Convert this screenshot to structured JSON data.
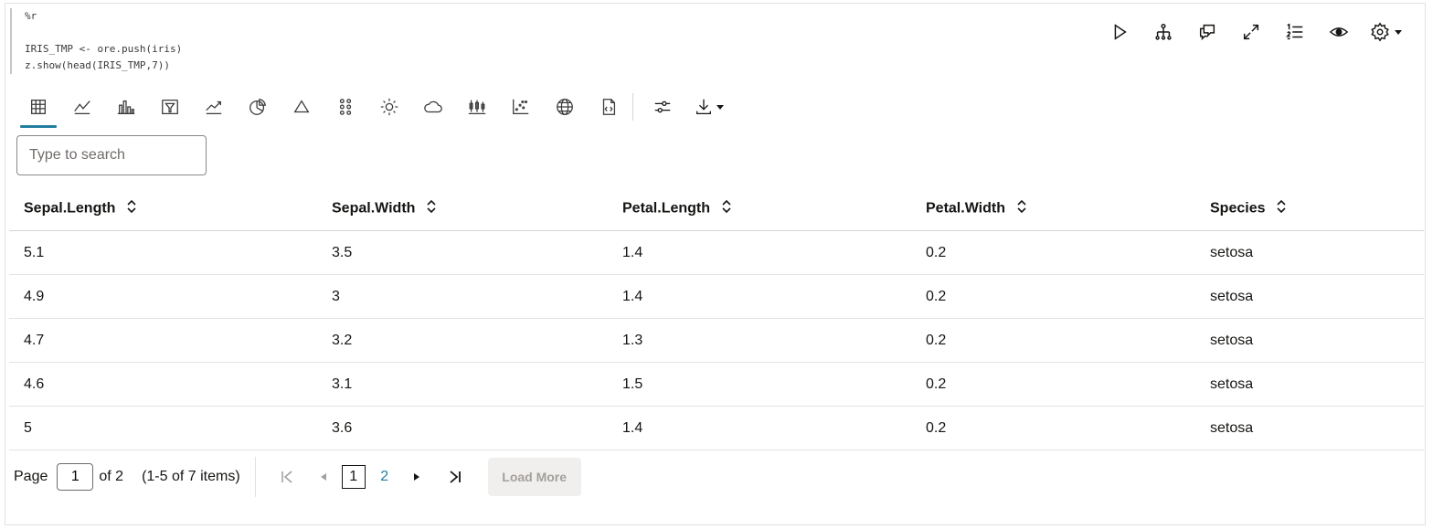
{
  "code": {
    "lines": [
      "%r",
      "",
      "IRIS_TMP <- ore.push(iris)",
      "z.show(head(IRIS_TMP,7))"
    ]
  },
  "cell_toolbar": {
    "icons": [
      "run-icon",
      "hierarchy-icon",
      "comments-icon",
      "expand-icon",
      "numbered-list-icon",
      "visibility-icon",
      "settings-icon"
    ]
  },
  "viz_toolbar": {
    "icons": [
      "table-icon",
      "line-chart-icon",
      "bar-chart-icon",
      "funnel-chart-icon",
      "trend-chart-icon",
      "pie-chart-icon",
      "triangle-chart-icon",
      "dot-grid-icon",
      "sun-icon",
      "cloud-icon",
      "boxplot-icon",
      "scatter-icon",
      "globe-icon",
      "code-file-icon",
      "settings-sliders-icon",
      "download-icon"
    ]
  },
  "search": {
    "placeholder": "Type to search"
  },
  "table": {
    "columns": [
      "Sepal.Length",
      "Sepal.Width",
      "Petal.Length",
      "Petal.Width",
      "Species"
    ],
    "rows": [
      [
        "5.1",
        "3.5",
        "1.4",
        "0.2",
        "setosa"
      ],
      [
        "4.9",
        "3",
        "1.4",
        "0.2",
        "setosa"
      ],
      [
        "4.7",
        "3.2",
        "1.3",
        "0.2",
        "setosa"
      ],
      [
        "4.6",
        "3.1",
        "1.5",
        "0.2",
        "setosa"
      ],
      [
        "5",
        "3.6",
        "1.4",
        "0.2",
        "setosa"
      ]
    ]
  },
  "pager": {
    "page_label": "Page",
    "page_value": "1",
    "of_label": "of 2",
    "range_label": "(1-5 of 7 items)",
    "current_page": "1",
    "next_page": "2",
    "load_more": "Load More"
  },
  "colors": {
    "accent": "#227e9e",
    "text": "#161513",
    "code_operator": "#3c9a48",
    "code_number": "#b4412d"
  }
}
